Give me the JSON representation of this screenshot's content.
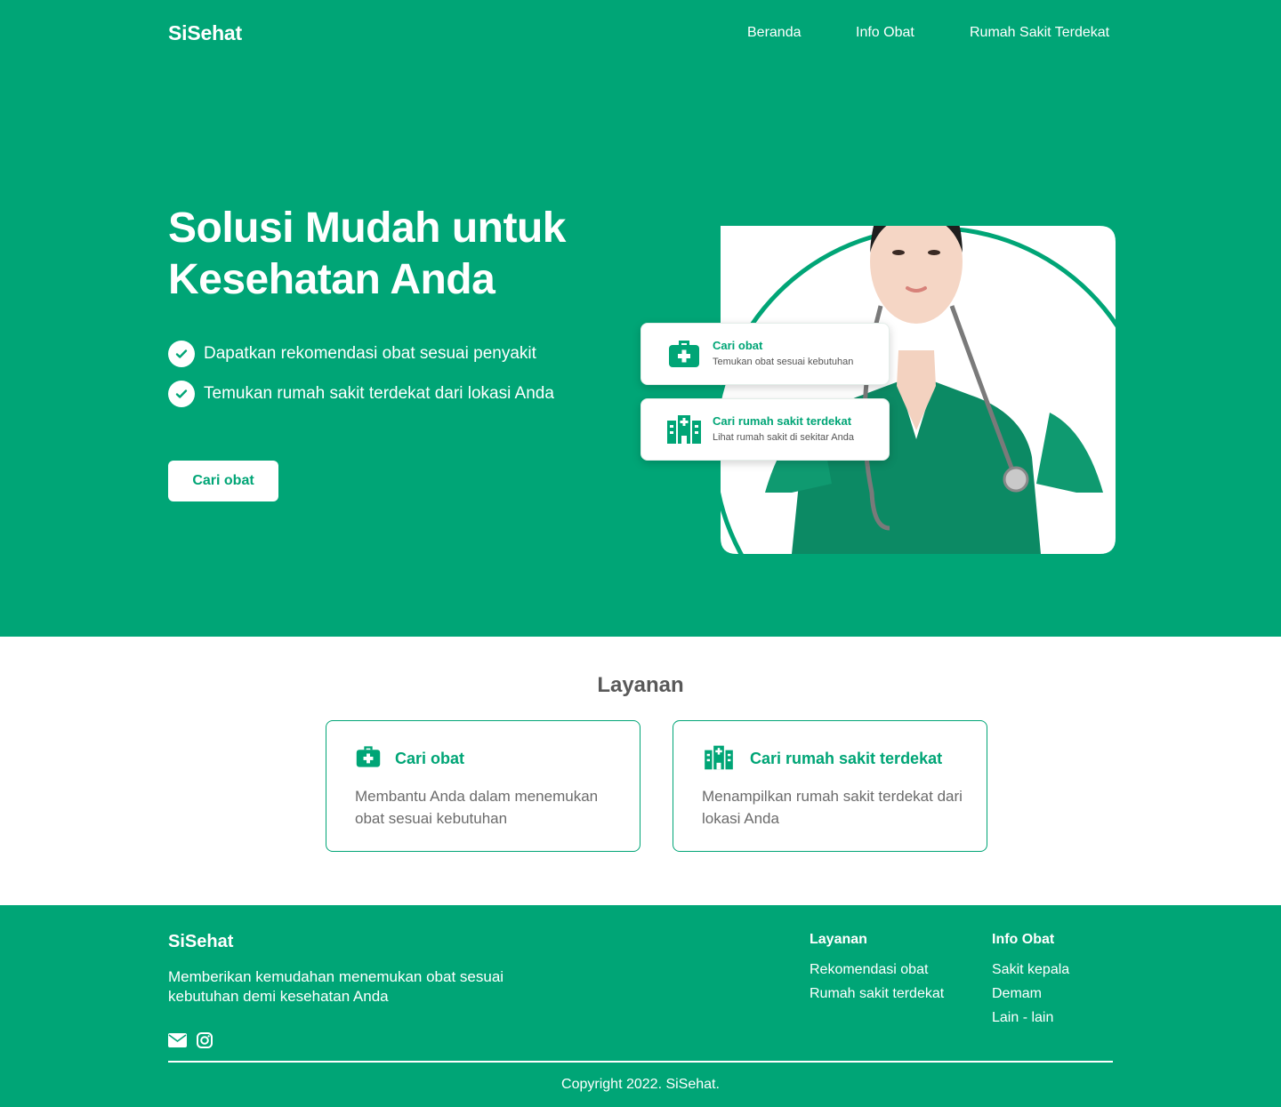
{
  "brand": "SiSehat",
  "nav": [
    "Beranda",
    "Info Obat",
    "Rumah Sakit Terdekat"
  ],
  "hero": {
    "title_line1": "Solusi Mudah untuk",
    "title_line2": "Kesehatan Anda",
    "features": [
      "Dapatkan rekomendasi obat sesuai penyakit",
      "Temukan rumah sakit terdekat dari lokasi Anda"
    ],
    "cta": "Cari obat",
    "cards": [
      {
        "title": "Cari obat",
        "subtitle": "Temukan obat sesuai kebutuhan"
      },
      {
        "title": "Cari rumah sakit terdekat",
        "subtitle": "Lihat rumah sakit di sekitar Anda"
      }
    ]
  },
  "services": {
    "title": "Layanan",
    "items": [
      {
        "title": "Cari obat",
        "desc": "Membantu Anda dalam menemukan obat sesuai kebutuhan",
        "icon": "medkit-icon"
      },
      {
        "title": "Cari rumah sakit terdekat",
        "desc": "Menampilkan rumah sakit terdekat dari lokasi Anda",
        "icon": "hospital-icon"
      }
    ]
  },
  "footer": {
    "brand": "SiSehat",
    "desc": "Memberikan kemudahan menemukan obat sesuai kebutuhan demi kesehatan Anda",
    "col1": {
      "title": "Layanan",
      "links": [
        "Rekomendasi obat",
        "Rumah sakit terdekat"
      ]
    },
    "col2": {
      "title": "Info Obat",
      "links": [
        "Sakit kepala",
        "Demam",
        "Lain - lain"
      ]
    },
    "social": [
      "mail-icon",
      "instagram-icon"
    ],
    "copyright": "Copyright 2022. SiSehat."
  },
  "colors": {
    "primary": "#00A576",
    "white": "#FFFFFF"
  }
}
